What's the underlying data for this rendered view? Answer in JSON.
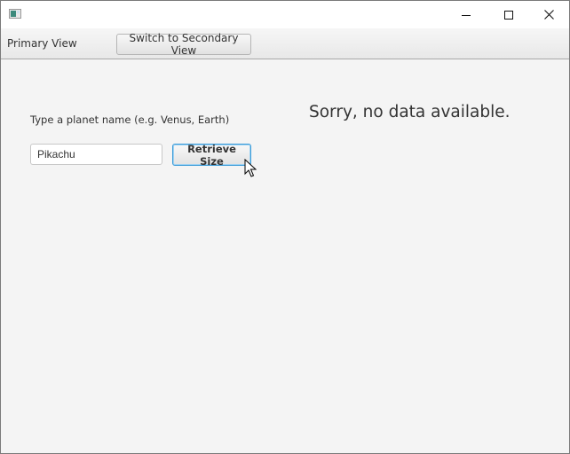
{
  "window": {
    "controls": {
      "minimize": "minimize-icon",
      "maximize": "maximize-icon",
      "close": "close-icon"
    }
  },
  "toolbar": {
    "view_label": "Primary View",
    "switch_button": "Switch to Secondary View"
  },
  "main": {
    "prompt": "Type a planet name (e.g. Venus, Earth)",
    "planet_input_value": "Pikachu",
    "retrieve_button": "Retrieve Size",
    "result_message": "Sorry, no data available."
  },
  "colors": {
    "focus_border": "#3a9bd8",
    "background": "#f4f4f4"
  }
}
